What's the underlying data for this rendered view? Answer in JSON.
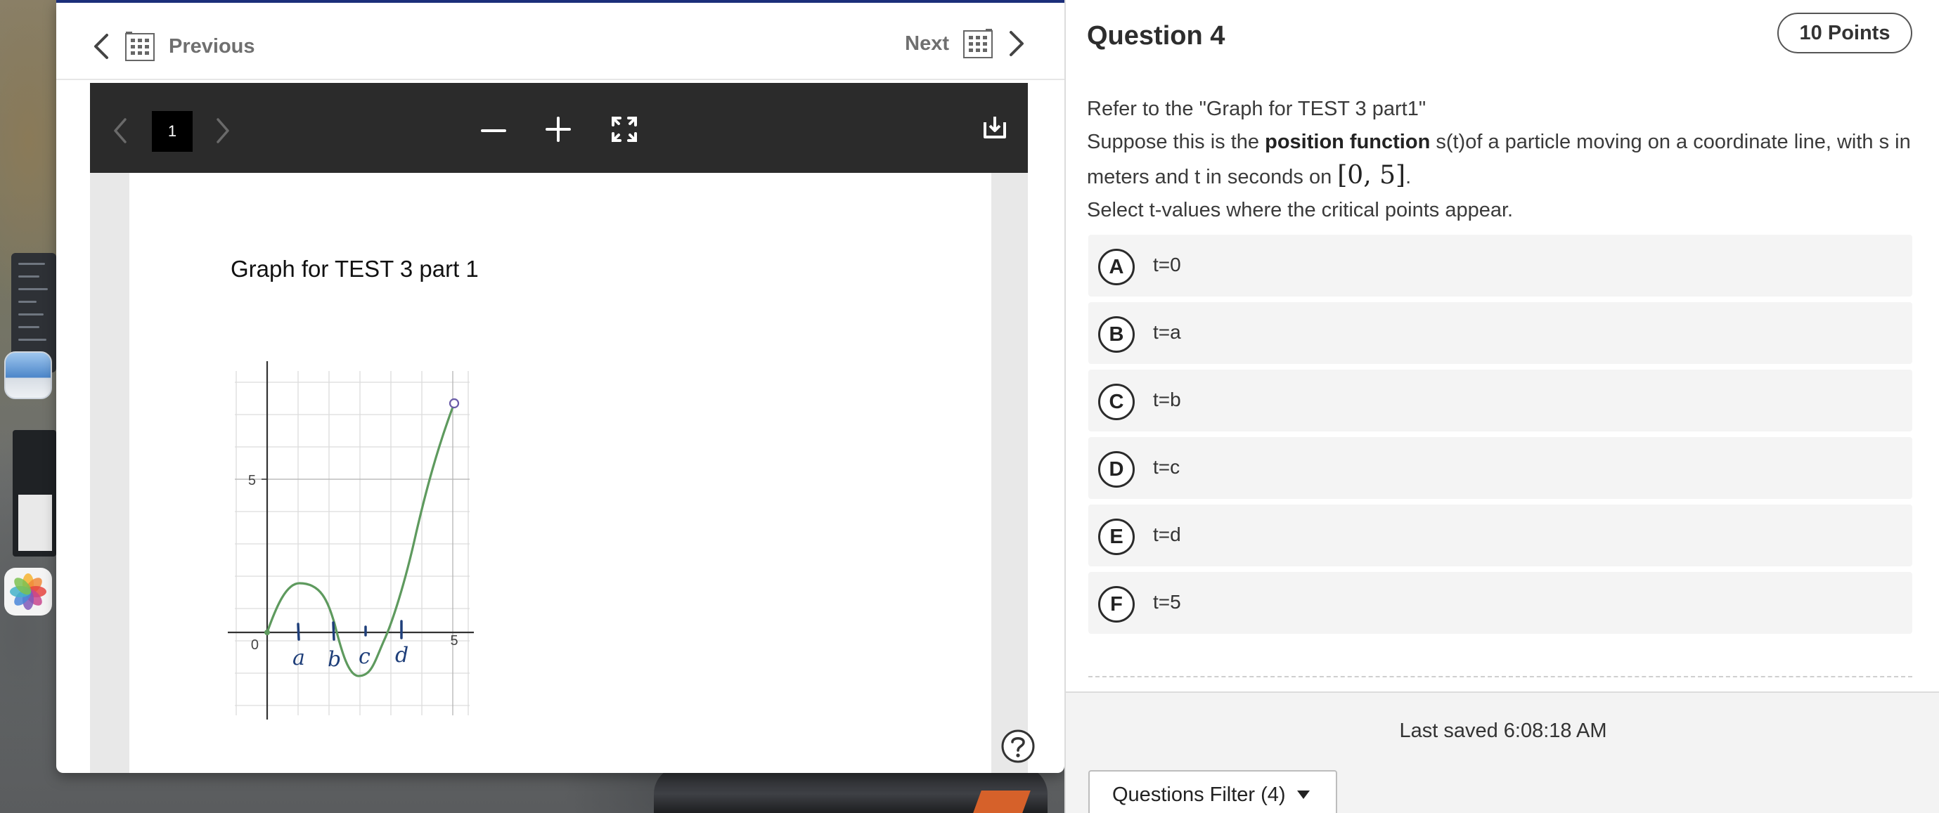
{
  "viewer": {
    "prev_label": "Previous",
    "next_label": "Next",
    "page_number": "1",
    "page_title": "Graph for TEST 3 part 1",
    "graph": {
      "y_tick_label": "5",
      "x_origin_label": "0",
      "x_end_label": "5",
      "point_labels": [
        "a",
        "b",
        "c",
        "d"
      ]
    }
  },
  "question": {
    "title": "Question 4",
    "points": "10 Points",
    "line1": "Refer to the \"Graph for TEST 3 part1\"",
    "line2_pre": "Suppose this is the ",
    "line2_bold": "position function",
    "line2_post": " s(t)of a particle moving on a coordinate line, with s in meters and t in seconds on ",
    "interval": "[0, 5]",
    "line2_end": ".",
    "line3": "Select t-values where the critical points appear.",
    "options": [
      {
        "letter": "A",
        "text": "t=0"
      },
      {
        "letter": "B",
        "text": "t=a"
      },
      {
        "letter": "C",
        "text": "t=b"
      },
      {
        "letter": "D",
        "text": "t=c"
      },
      {
        "letter": "E",
        "text": "t=d"
      },
      {
        "letter": "F",
        "text": "t=5"
      }
    ]
  },
  "footer": {
    "last_saved": "Last saved 6:08:18 AM",
    "filter_label": "Questions Filter (4)"
  },
  "colors": {
    "accent_bar": "#1c2f7a",
    "curve": "#5e9a5e",
    "handwriting": "#1f3f7a",
    "toolbar": "#2b2b2b"
  },
  "icons": {
    "prev": "chevron-left-icon",
    "next": "chevron-right-icon",
    "grid": "question-grid-icon",
    "zoom_out": "minus-icon",
    "zoom_in": "plus-icon",
    "fullscreen": "fullscreen-icon",
    "download": "download-icon",
    "help": "help-icon"
  }
}
